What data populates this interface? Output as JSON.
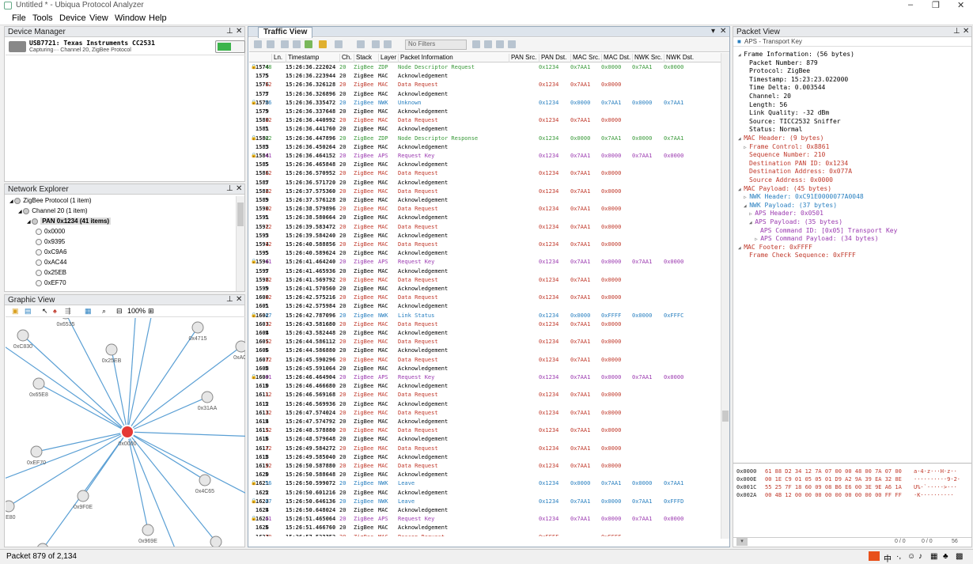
{
  "app": {
    "title": "Untitled * - Ubiqua Protocol Analyzer",
    "window_controls": [
      "–",
      "❐",
      "✕"
    ]
  },
  "menu": [
    "File",
    "Tools",
    "Device",
    "View",
    "Window",
    "Help"
  ],
  "device_manager": {
    "title": "Device Manager",
    "device_name": "USB7721: Texas Instruments CC2531",
    "device_status": "Capturing··· Channel 20, ZigBee Protocol"
  },
  "network_explorer": {
    "title": "Network Explorer",
    "tree": [
      {
        "level": 0,
        "label": "ZigBee Protocol (1 item)",
        "arrow": "◢"
      },
      {
        "level": 1,
        "label": "Channel 20 (1 item)",
        "arrow": "◢"
      },
      {
        "level": 2,
        "label": "PAN 0x1234 (41 items)",
        "arrow": "◢",
        "selected": true
      },
      {
        "level": 3,
        "label": "0x0000"
      },
      {
        "level": 3,
        "label": "0x9395"
      },
      {
        "level": 3,
        "label": "0xC9A6"
      },
      {
        "level": 3,
        "label": "0xAC44"
      },
      {
        "level": 3,
        "label": "0x25EB"
      },
      {
        "level": 3,
        "label": "0xEF70"
      }
    ]
  },
  "graphic_view": {
    "title": "Graphic View",
    "zoom": "100%",
    "center_label": "0x0000",
    "nodes": [
      {
        "label": "0x6535"
      },
      {
        "label": "0xC830"
      },
      {
        "label": "0x4715"
      },
      {
        "label": "0x25EB"
      },
      {
        "label": "0xA06"
      },
      {
        "label": "0x65E8"
      },
      {
        "label": "0x31AA"
      },
      {
        "label": "0xEF70"
      },
      {
        "label": "0x4C65"
      },
      {
        "label": "EE80"
      },
      {
        "label": "0x9F0E"
      },
      {
        "label": "0x969E"
      },
      {
        "label": ""
      },
      {
        "label": ""
      },
      {
        "label": ""
      }
    ]
  },
  "traffic_view": {
    "tab": "Traffic View",
    "filter": "No Filters",
    "columns": [
      "Ln.",
      "Timestamp",
      "Ch.",
      "Stack",
      "Layer",
      "Packet Information",
      "PAN Src.",
      "PAN Dst.",
      "MAC Src.",
      "MAC Dst.",
      "NWK Src.",
      "NWK Dst."
    ],
    "colors": {
      "ZDP": "#3a9a3a",
      "MAC": "#c0392b",
      "NWK": "#2a80c0",
      "APS": "#9b3ab0",
      "ACK": "#000000"
    },
    "rows": [
      [
        "1574",
        "48",
        "15:26:36.222024",
        "20",
        "ZigBee",
        "ZDP",
        "Node Descriptor Request",
        "",
        "0x1234",
        "0x7AA1",
        "0x0000",
        "0x7AA1",
        "0x0000"
      ],
      [
        "1575",
        "5",
        "15:26:36.223944",
        "20",
        "ZigBee",
        "MAC",
        "Acknowledgement",
        "",
        "",
        "",
        "",
        "",
        ""
      ],
      [
        "1576",
        "12",
        "15:26:36.326128",
        "20",
        "ZigBee",
        "MAC",
        "Data Request",
        "",
        "0x1234",
        "0x7AA1",
        "0x0000",
        "",
        ""
      ],
      [
        "1577",
        "5",
        "15:26:36.326896",
        "20",
        "ZigBee",
        "MAC",
        "Acknowledgement",
        "",
        "",
        "",
        "",
        "",
        ""
      ],
      [
        "1578",
        "56",
        "15:26:36.335472",
        "20",
        "ZigBee",
        "NWK",
        "Unknown",
        "",
        "0x1234",
        "0x0000",
        "0x7AA1",
        "0x0000",
        "0x7AA1"
      ],
      [
        "1579",
        "5",
        "15:26:36.337648",
        "20",
        "ZigBee",
        "MAC",
        "Acknowledgement",
        "",
        "",
        "",
        "",
        "",
        ""
      ],
      [
        "1580",
        "12",
        "15:26:36.440992",
        "20",
        "ZigBee",
        "MAC",
        "Data Request",
        "",
        "0x1234",
        "0x7AA1",
        "0x0000",
        "",
        ""
      ],
      [
        "1581",
        "5",
        "15:26:36.441760",
        "20",
        "ZigBee",
        "MAC",
        "Acknowledgement",
        "",
        "",
        "",
        "",
        "",
        ""
      ],
      [
        "1582",
        "62",
        "15:26:36.447896",
        "20",
        "ZigBee",
        "ZDP",
        "Node Descriptor Response",
        "",
        "0x1234",
        "0x0000",
        "0x7AA1",
        "0x0000",
        "0x7AA1"
      ],
      [
        "1583",
        "5",
        "15:26:36.450264",
        "20",
        "ZigBee",
        "MAC",
        "Acknowledgement",
        "",
        "",
        "",
        "",
        "",
        ""
      ],
      [
        "1584",
        "41",
        "15:26:36.464152",
        "20",
        "ZigBee",
        "APS",
        "Request Key",
        "",
        "0x1234",
        "0x7AA1",
        "0x0000",
        "0x7AA1",
        "0x0000"
      ],
      [
        "1585",
        "5",
        "15:26:36.465848",
        "20",
        "ZigBee",
        "MAC",
        "Acknowledgement",
        "",
        "",
        "",
        "",
        "",
        ""
      ],
      [
        "1586",
        "12",
        "15:26:36.570952",
        "20",
        "ZigBee",
        "MAC",
        "Data Request",
        "",
        "0x1234",
        "0x7AA1",
        "0x0000",
        "",
        ""
      ],
      [
        "1587",
        "5",
        "15:26:36.571720",
        "20",
        "ZigBee",
        "MAC",
        "Acknowledgement",
        "",
        "",
        "",
        "",
        "",
        ""
      ],
      [
        "1588",
        "12",
        "15:26:37.575360",
        "20",
        "ZigBee",
        "MAC",
        "Data Request",
        "",
        "0x1234",
        "0x7AA1",
        "0x0000",
        "",
        ""
      ],
      [
        "1589",
        "5",
        "15:26:37.576128",
        "20",
        "ZigBee",
        "MAC",
        "Acknowledgement",
        "",
        "",
        "",
        "",
        "",
        ""
      ],
      [
        "1590",
        "12",
        "15:26:38.579896",
        "20",
        "ZigBee",
        "MAC",
        "Data Request",
        "",
        "0x1234",
        "0x7AA1",
        "0x0000",
        "",
        ""
      ],
      [
        "1591",
        "5",
        "15:26:38.580664",
        "20",
        "ZigBee",
        "MAC",
        "Acknowledgement",
        "",
        "",
        "",
        "",
        "",
        ""
      ],
      [
        "1592",
        "12",
        "15:26:39.583472",
        "20",
        "ZigBee",
        "MAC",
        "Data Request",
        "",
        "0x1234",
        "0x7AA1",
        "0x0000",
        "",
        ""
      ],
      [
        "1593",
        "5",
        "15:26:39.584240",
        "20",
        "ZigBee",
        "MAC",
        "Acknowledgement",
        "",
        "",
        "",
        "",
        "",
        ""
      ],
      [
        "1594",
        "12",
        "15:26:40.588856",
        "20",
        "ZigBee",
        "MAC",
        "Data Request",
        "",
        "0x1234",
        "0x7AA1",
        "0x0000",
        "",
        ""
      ],
      [
        "1595",
        "5",
        "15:26:40.589624",
        "20",
        "ZigBee",
        "MAC",
        "Acknowledgement",
        "",
        "",
        "",
        "",
        "",
        ""
      ],
      [
        "1596",
        "41",
        "15:26:41.464240",
        "20",
        "ZigBee",
        "APS",
        "Request Key",
        "",
        "0x1234",
        "0x7AA1",
        "0x0000",
        "0x7AA1",
        "0x0000"
      ],
      [
        "1597",
        "5",
        "15:26:41.465936",
        "20",
        "ZigBee",
        "MAC",
        "Acknowledgement",
        "",
        "",
        "",
        "",
        "",
        ""
      ],
      [
        "1598",
        "12",
        "15:26:41.569792",
        "20",
        "ZigBee",
        "MAC",
        "Data Request",
        "",
        "0x1234",
        "0x7AA1",
        "0x0000",
        "",
        ""
      ],
      [
        "1599",
        "5",
        "15:26:41.570560",
        "20",
        "ZigBee",
        "MAC",
        "Acknowledgement",
        "",
        "",
        "",
        "",
        "",
        ""
      ],
      [
        "1600",
        "12",
        "15:26:42.575216",
        "20",
        "ZigBee",
        "MAC",
        "Data Request",
        "",
        "0x1234",
        "0x7AA1",
        "0x0000",
        "",
        ""
      ],
      [
        "1601",
        "5",
        "15:26:42.575984",
        "20",
        "ZigBee",
        "MAC",
        "Acknowledgement",
        "",
        "",
        "",
        "",
        "",
        ""
      ],
      [
        "1602",
        "47",
        "15:26:42.787096",
        "20",
        "ZigBee",
        "NWK",
        "Link Status",
        "",
        "0x1234",
        "0x0000",
        "0xFFFF",
        "0x0000",
        "0xFFFC"
      ],
      [
        "1603",
        "12",
        "15:26:43.581680",
        "20",
        "ZigBee",
        "MAC",
        "Data Request",
        "",
        "0x1234",
        "0x7AA1",
        "0x0000",
        "",
        ""
      ],
      [
        "1604",
        "5",
        "15:26:43.582448",
        "20",
        "ZigBee",
        "MAC",
        "Acknowledgement",
        "",
        "",
        "",
        "",
        "",
        ""
      ],
      [
        "1605",
        "12",
        "15:26:44.586112",
        "20",
        "ZigBee",
        "MAC",
        "Data Request",
        "",
        "0x1234",
        "0x7AA1",
        "0x0000",
        "",
        ""
      ],
      [
        "1606",
        "5",
        "15:26:44.586880",
        "20",
        "ZigBee",
        "MAC",
        "Acknowledgement",
        "",
        "",
        "",
        "",
        "",
        ""
      ],
      [
        "1607",
        "12",
        "15:26:45.590296",
        "20",
        "ZigBee",
        "MAC",
        "Data Request",
        "",
        "0x1234",
        "0x7AA1",
        "0x0000",
        "",
        ""
      ],
      [
        "1608",
        "5",
        "15:26:45.591064",
        "20",
        "ZigBee",
        "MAC",
        "Acknowledgement",
        "",
        "",
        "",
        "",
        "",
        ""
      ],
      [
        "1609",
        "41",
        "15:26:46.464904",
        "20",
        "ZigBee",
        "APS",
        "Request Key",
        "",
        "0x1234",
        "0x7AA1",
        "0x0000",
        "0x7AA1",
        "0x0000"
      ],
      [
        "1610",
        "5",
        "15:26:46.466680",
        "20",
        "ZigBee",
        "MAC",
        "Acknowledgement",
        "",
        "",
        "",
        "",
        "",
        ""
      ],
      [
        "1611",
        "12",
        "15:26:46.569168",
        "20",
        "ZigBee",
        "MAC",
        "Data Request",
        "",
        "0x1234",
        "0x7AA1",
        "0x0000",
        "",
        ""
      ],
      [
        "1612",
        "5",
        "15:26:46.569936",
        "20",
        "ZigBee",
        "MAC",
        "Acknowledgement",
        "",
        "",
        "",
        "",
        "",
        ""
      ],
      [
        "1613",
        "12",
        "15:26:47.574024",
        "20",
        "ZigBee",
        "MAC",
        "Data Request",
        "",
        "0x1234",
        "0x7AA1",
        "0x0000",
        "",
        ""
      ],
      [
        "1614",
        "5",
        "15:26:47.574792",
        "20",
        "ZigBee",
        "MAC",
        "Acknowledgement",
        "",
        "",
        "",
        "",
        "",
        ""
      ],
      [
        "1615",
        "12",
        "15:26:48.578880",
        "20",
        "ZigBee",
        "MAC",
        "Data Request",
        "",
        "0x1234",
        "0x7AA1",
        "0x0000",
        "",
        ""
      ],
      [
        "1616",
        "5",
        "15:26:48.579648",
        "20",
        "ZigBee",
        "MAC",
        "Acknowledgement",
        "",
        "",
        "",
        "",
        "",
        ""
      ],
      [
        "1617",
        "12",
        "15:26:49.584272",
        "20",
        "ZigBee",
        "MAC",
        "Data Request",
        "",
        "0x1234",
        "0x7AA1",
        "0x0000",
        "",
        ""
      ],
      [
        "1618",
        "5",
        "15:26:49.585040",
        "20",
        "ZigBee",
        "MAC",
        "Acknowledgement",
        "",
        "",
        "",
        "",
        "",
        ""
      ],
      [
        "1619",
        "12",
        "15:26:50.587880",
        "20",
        "ZigBee",
        "MAC",
        "Data Request",
        "",
        "0x1234",
        "0x7AA1",
        "0x0000",
        "",
        ""
      ],
      [
        "1620",
        "5",
        "15:26:50.588648",
        "20",
        "ZigBee",
        "MAC",
        "Acknowledgement",
        "",
        "",
        "",
        "",
        "",
        ""
      ],
      [
        "1621",
        "56",
        "15:26:50.599072",
        "20",
        "ZigBee",
        "NWK",
        "Leave",
        "",
        "0x1234",
        "0x0000",
        "0x7AA1",
        "0x0000",
        "0x7AA1"
      ],
      [
        "1622",
        "5",
        "15:26:50.601216",
        "20",
        "ZigBee",
        "MAC",
        "Acknowledgement",
        "",
        "",
        "",
        "",
        "",
        ""
      ],
      [
        "1623",
        "47",
        "15:26:50.646136",
        "20",
        "ZigBee",
        "NWK",
        "Leave",
        "",
        "0x1234",
        "0x7AA1",
        "0x0000",
        "0x7AA1",
        "0xFFFD"
      ],
      [
        "1624",
        "5",
        "15:26:50.648024",
        "20",
        "ZigBee",
        "MAC",
        "Acknowledgement",
        "",
        "",
        "",
        "",
        "",
        ""
      ],
      [
        "1625",
        "41",
        "15:26:51.465064",
        "20",
        "ZigBee",
        "APS",
        "Request Key",
        "",
        "0x1234",
        "0x7AA1",
        "0x0000",
        "0x7AA1",
        "0x0000"
      ],
      [
        "1626",
        "5",
        "15:26:51.466760",
        "20",
        "ZigBee",
        "MAC",
        "Acknowledgement",
        "",
        "",
        "",
        "",
        "",
        ""
      ],
      [
        "1627",
        "10",
        "15:26:57.523352",
        "20",
        "ZigBee",
        "MAC",
        "Beacon Request",
        "",
        "0xFFFF",
        "",
        "0xFFFF",
        "",
        ""
      ]
    ],
    "locked_rows": [
      "1574",
      "1578",
      "1582",
      "1584",
      "1596",
      "1602",
      "1609",
      "1621",
      "1623",
      "1625"
    ]
  },
  "packet_view": {
    "title": "Packet View",
    "subtitle": "APS - Transport Key",
    "lines": [
      {
        "indent": 0,
        "arrow": "◢",
        "text": "Frame Information: (56 bytes)",
        "color": "#000000"
      },
      {
        "indent": 2,
        "text": "Packet Number: 879",
        "color": "#000000"
      },
      {
        "indent": 2,
        "text": "Protocol: ZigBee",
        "color": "#000000"
      },
      {
        "indent": 2,
        "text": "Timestamp: 15:23:23.022000",
        "color": "#000000"
      },
      {
        "indent": 2,
        "text": "Time Delta: 0.003544",
        "color": "#000000"
      },
      {
        "indent": 2,
        "text": "Channel: 20",
        "color": "#000000"
      },
      {
        "indent": 2,
        "text": "Length: 56",
        "color": "#000000"
      },
      {
        "indent": 2,
        "text": "Link Quality: -32 dBm",
        "color": "#000000"
      },
      {
        "indent": 2,
        "text": "Source: TICC2532 Sniffer",
        "color": "#000000"
      },
      {
        "indent": 2,
        "text": "Status: Normal",
        "color": "#000000"
      },
      {
        "indent": 0,
        "arrow": "◢",
        "text": "MAC Header: (9 bytes)",
        "color": "#c0392b"
      },
      {
        "indent": 1,
        "arrow": "▷",
        "text": "Frame Control: 0x8861",
        "color": "#c0392b"
      },
      {
        "indent": 2,
        "text": "Sequence Number: 210",
        "color": "#c0392b"
      },
      {
        "indent": 2,
        "text": "Destination PAN ID: 0x1234",
        "color": "#c0392b"
      },
      {
        "indent": 2,
        "text": "Destination Address: 0x077A",
        "color": "#c0392b"
      },
      {
        "indent": 2,
        "text": "Source Address: 0x0000",
        "color": "#c0392b"
      },
      {
        "indent": 0,
        "arrow": "◢",
        "text": "MAC Payload: (45 bytes)",
        "color": "#c0392b"
      },
      {
        "indent": 1,
        "arrow": "▷",
        "text": "NWK Header: 0xC91E0000077A0048",
        "color": "#2a80c0"
      },
      {
        "indent": 1,
        "arrow": "◢",
        "text": "NWK Payload: (37 bytes)",
        "color": "#2a80c0"
      },
      {
        "indent": 2,
        "arrow": "▷",
        "text": "APS Header: 0x0501",
        "color": "#9b3ab0"
      },
      {
        "indent": 2,
        "arrow": "◢",
        "text": "APS Payload: (35 bytes)",
        "color": "#9b3ab0"
      },
      {
        "indent": 4,
        "text": "APS Command ID: [0x05] Transport Key",
        "color": "#9b3ab0"
      },
      {
        "indent": 3,
        "arrow": "▷",
        "text": "APS Command Payload: (34 bytes)",
        "color": "#9b3ab0"
      },
      {
        "indent": 0,
        "arrow": "◢",
        "text": "MAC Footer: 0xFFFF",
        "color": "#c0392b"
      },
      {
        "indent": 2,
        "text": "Frame Check Sequence: 0xFFFF",
        "color": "#c0392b"
      }
    ],
    "hex": [
      {
        "offset": "0x0000",
        "bytes": "61 88 D2 34 12 7A 07 00 00 48 00 7A 07 00",
        "ascii": "a·4·z···H·z··"
      },
      {
        "offset": "0x000E",
        "bytes": "00 1E C9 01 05 05 01 D9 A2 9A 39 EA 32 8E",
        "ascii": "··········9·2·"
      },
      {
        "offset": "0x001C",
        "bytes": "55 25 7F 18 60 09 08 B6 E6 00 3E 9E A6 1A",
        "ascii": "U%·`·····>···"
      },
      {
        "offset": "0x002A",
        "bytes": "00 4B 12 00 00 00 00 00 00 00 00 00 FF FF",
        "ascii": "·K··········"
      }
    ],
    "footer": [
      "0 / 0",
      "0 / 0",
      "56"
    ]
  },
  "status": {
    "packet_count": "Packet 879 of 2,134",
    "tray": [
      "中",
      "·,"
    ]
  }
}
